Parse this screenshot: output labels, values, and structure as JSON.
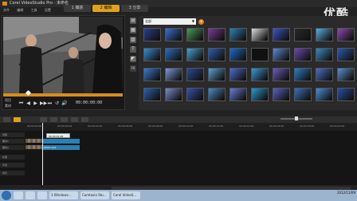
{
  "window": {
    "title": "Corel VideoStudio Pro - 未命名"
  },
  "menu": [
    "文件",
    "编辑",
    "工具",
    "设置"
  ],
  "steps": [
    {
      "label": "1 捕获"
    },
    {
      "label": "2 编辑"
    },
    {
      "label": "3 分享"
    }
  ],
  "watermark": "优酷",
  "preview": {
    "mode_project": "项目",
    "mode_clip": "素材",
    "timecode": "00:00:00:00",
    "buttons": [
      "⏮",
      "◀",
      "▶",
      "▶▶",
      "⏭",
      "↺",
      "🔊"
    ]
  },
  "library": {
    "side_icons": [
      "media-icon",
      "transition-icon",
      "title-icon",
      "graphics-icon",
      "filter-icon"
    ],
    "dropdown_value": "全部",
    "fx_label": "FX",
    "items": [
      {
        "caption": "",
        "color": "#2a3d8f"
      },
      {
        "caption": "",
        "color": "#3a6fd8"
      },
      {
        "caption": "",
        "color": "#4a9a5a"
      },
      {
        "caption": "",
        "color": "#7a3a9a"
      },
      {
        "caption": "",
        "color": "#2c7fb3"
      },
      {
        "caption": "",
        "color": "#dddddd"
      },
      {
        "caption": "",
        "color": "#3a55c8"
      },
      {
        "caption": "",
        "color": "#2a2a2a"
      },
      {
        "caption": "",
        "color": "#5ab0e0"
      },
      {
        "caption": "",
        "color": "#8a4ab0"
      },
      {
        "caption": "",
        "color": "#3a8ad8"
      },
      {
        "caption": "",
        "color": "#2a70c0"
      },
      {
        "caption": "",
        "color": "#4aa0d8"
      },
      {
        "caption": "",
        "color": "#2c5fb3"
      },
      {
        "caption": "",
        "color": "#1a6ad0"
      },
      {
        "caption": "",
        "color": "#111111"
      },
      {
        "caption": "",
        "color": "#5a8ad8"
      },
      {
        "caption": "",
        "color": "#6a4ab0"
      },
      {
        "caption": "",
        "color": "#3a8ac8"
      },
      {
        "caption": "",
        "color": "#2a5ab0"
      },
      {
        "caption": "",
        "color": "#3a78d0"
      },
      {
        "caption": "",
        "color": "#7a9ae0"
      },
      {
        "caption": "",
        "color": "#2a4a9a"
      },
      {
        "caption": "",
        "color": "#5aa0d8"
      },
      {
        "caption": "",
        "color": "#4a6ad0"
      },
      {
        "caption": "",
        "color": "#3a9ad8"
      },
      {
        "caption": "",
        "color": "#6a5ac0"
      },
      {
        "caption": "",
        "color": "#2a80c8"
      },
      {
        "caption": "",
        "color": "#4a70c8"
      },
      {
        "caption": "",
        "color": "#5a90d0"
      },
      {
        "caption": "",
        "color": "#2a60b0"
      },
      {
        "caption": "",
        "color": "#7a8ad0"
      },
      {
        "caption": "",
        "color": "#3a50b0"
      },
      {
        "caption": "",
        "color": "#4a8ac8"
      },
      {
        "caption": "",
        "color": "#6a7ad8"
      },
      {
        "caption": "",
        "color": "#2a9ad0"
      },
      {
        "caption": "",
        "color": "#5a60c0"
      },
      {
        "caption": "",
        "color": "#3a70b8"
      },
      {
        "caption": "",
        "color": "#4a90d8"
      },
      {
        "caption": "",
        "color": "#2a50a8"
      }
    ]
  },
  "timeline": {
    "ruler": [
      "00:00:00:00",
      "00:00:02:00",
      "00:00:04:00",
      "00:00:06:00",
      "00:00:08:00",
      "00:00:10:00",
      "00:00:12:00",
      "00:00:14:00",
      "00:00:16:00",
      "00:00:18:00",
      "00:00:20:00"
    ],
    "tracks": [
      "视频",
      "覆叠1",
      "覆叠2",
      "标题",
      "声音",
      "音乐"
    ],
    "clip_tooltip": "00:00:01:08",
    "clip_labels": [
      "",
      "0006.mp4"
    ]
  },
  "taskbar": {
    "items": [
      "3 Windows...",
      "Camtasia Stu...",
      "Corel VideoS..."
    ],
    "clock": "2012/11/09"
  }
}
